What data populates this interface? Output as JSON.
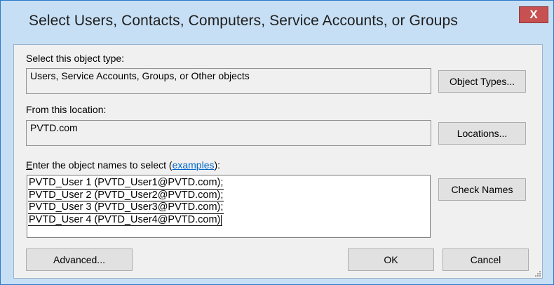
{
  "window": {
    "title": "Select Users, Contacts, Computers, Service Accounts, or Groups",
    "close_glyph": "X"
  },
  "object_type": {
    "label": "Select this object type:",
    "value": "Users, Service Accounts, Groups, or Other objects",
    "button": "Object Types..."
  },
  "location": {
    "label": "From this location:",
    "value": "PVTD.com",
    "button": "Locations..."
  },
  "names": {
    "label_accel": "E",
    "label_rest": "nter the object names to select (",
    "link": "examples",
    "label_end": "):",
    "entries": [
      "PVTD_User 1 (PVTD_User1@PVTD.com);",
      "PVTD_User 2 (PVTD_User2@PVTD.com);",
      "PVTD_User 3 (PVTD_User3@PVTD.com);",
      "PVTD_User 4 (PVTD_User4@PVTD.com)"
    ],
    "check_button": "Check Names"
  },
  "footer": {
    "advanced": "Advanced...",
    "ok": "OK",
    "cancel": "Cancel"
  },
  "colors": {
    "frame": "#c7dff4",
    "close": "#c75050",
    "link": "#0066cc"
  }
}
